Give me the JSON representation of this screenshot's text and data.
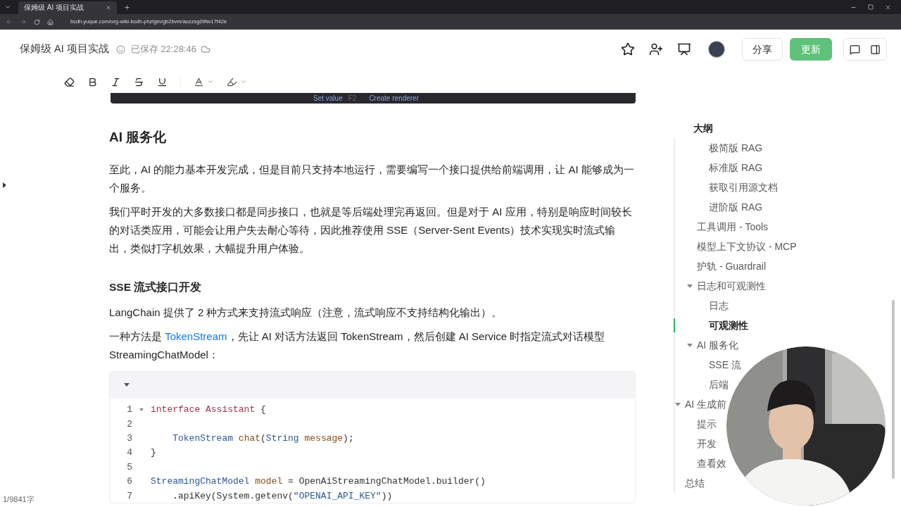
{
  "browser": {
    "tab_title": "保姆级 AI 项目实战",
    "url": "bcdh.yuque.com/org-wiki-bcdh-phztgm/gb2bvm/aozzsg09fw17f42e"
  },
  "header": {
    "title": "保姆级 AI 项目实战",
    "saved": "已保存 22:28:46",
    "share": "分享",
    "update": "更新"
  },
  "renderer_bar": {
    "set_value": "Set value",
    "shortcut": "F2",
    "create": "Create renderer"
  },
  "article": [
    {
      "kind": "h2",
      "text": "AI 服务化"
    },
    {
      "kind": "p",
      "parts": [
        {
          "text": "至此，AI 的能力基本开发完成，但是目前只支持本地运行，需要编写一个接口提供给前端调用，让 AI 能够成为一个服务。"
        }
      ]
    },
    {
      "kind": "p",
      "parts": [
        {
          "text": "我们平时开发的大多数接口都是同步接口，也就是等后端处理完再返回。但是对于 AI 应用，特别是响应时间较长的对话类应用，可能会让用户失去耐心等待，因此推荐使用 SSE（Server-Sent Events）技术实现实时流式输出，类似打字机效果，大幅提升用户体验。"
        }
      ]
    },
    {
      "kind": "h3",
      "text": "SSE 流式接口开发"
    },
    {
      "kind": "p",
      "parts": [
        {
          "text": "LangChain 提供了 2 种方式来支持流式响应（注意，流式响应不支持结构化输出）。"
        }
      ]
    },
    {
      "kind": "p",
      "parts": [
        {
          "text": "一种方法是 "
        },
        {
          "text": "TokenStream",
          "kind": "link"
        },
        {
          "text": "，先让 AI 对话方法返回 TokenStream，然后创建 AI Service 时指定流式对话模型 StreamingChatModel："
        }
      ]
    },
    {
      "kind": "code",
      "expanded": true,
      "lines": [
        {
          "n": "1",
          "fold": true,
          "tokens": [
            {
              "text": "interface Assistant",
              "kind": "keyword"
            },
            {
              "text": " {",
              "kind": "plain"
            }
          ]
        },
        {
          "n": "2",
          "fold": false
        },
        {
          "n": "3",
          "fold": false,
          "tokens": [
            {
              "text": "    TokenStream",
              "kind": "type"
            },
            {
              "text": " chat",
              "kind": "variable"
            },
            {
              "text": "(",
              "kind": "plain"
            },
            {
              "text": "String",
              "kind": "type"
            },
            {
              "text": " message",
              "kind": "variable"
            },
            {
              "text": ");",
              "kind": "plain"
            }
          ]
        },
        {
          "n": "4",
          "fold": false,
          "tokens": [
            {
              "text": "}",
              "kind": "plain"
            }
          ]
        },
        {
          "n": "5",
          "fold": false
        },
        {
          "n": "6",
          "fold": false,
          "tokens": [
            {
              "text": "StreamingChatModel",
              "kind": "type"
            },
            {
              "text": " model",
              "kind": "variable"
            },
            {
              "text": " = OpenAiStreamingChatModel.builder()",
              "kind": "plain"
            }
          ]
        },
        {
          "n": "7",
          "fold": false,
          "tokens": [
            {
              "text": "    .apiKey(System.getenv(",
              "kind": "plain"
            },
            {
              "text": "\"OPENAI_API_KEY\"",
              "kind": "string"
            },
            {
              "text": "))",
              "kind": "plain"
            }
          ]
        }
      ]
    }
  ],
  "outline": {
    "title": "大纲",
    "items": [
      {
        "children": [
          {
            "children": [
              {
                "label": "极简版 RAG",
                "selected": false
              },
              {
                "label": "标准版 RAG",
                "selected": false
              },
              {
                "label": "获取引用源文档",
                "selected": false
              },
              {
                "label": "进阶版 RAG",
                "selected": false
              }
            ]
          },
          {
            "label": "工具调用 - Tools",
            "selected": false
          },
          {
            "label": "模型上下文协议 - MCP",
            "selected": false
          },
          {
            "label": "护轨 - Guardrail",
            "selected": false
          },
          {
            "label": "日志和可观测性",
            "selected": false,
            "expanded": true,
            "children": [
              {
                "label": "日志",
                "selected": false
              },
              {
                "label": "可观测性",
                "selected": true
              }
            ]
          },
          {
            "label": "AI 服务化",
            "selected": false,
            "expanded": true,
            "children": [
              {
                "label": "SSE 流",
                "selected": false
              },
              {
                "label": "后端",
                "selected": false
              }
            ]
          }
        ]
      },
      {
        "label": "AI 生成前",
        "selected": false,
        "expanded": true,
        "children": [
          {
            "label": "提示",
            "selected": false
          },
          {
            "label": "开发",
            "selected": false
          },
          {
            "label": "查看效",
            "selected": false
          }
        ]
      },
      {
        "label": "总结",
        "selected": false
      }
    ]
  },
  "status": "1/9841字"
}
